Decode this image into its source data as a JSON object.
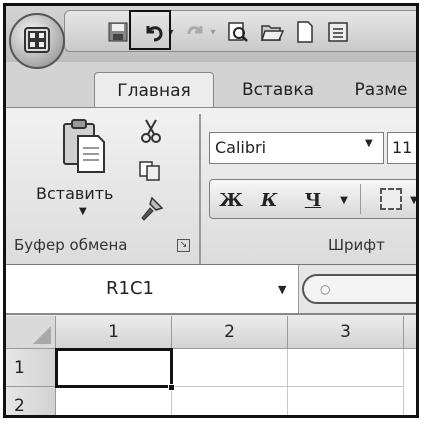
{
  "quick_access": {
    "office_button": "office-logo",
    "buttons": [
      "save-icon",
      "undo-icon",
      "undo-dropdown-icon",
      "redo-icon",
      "redo-dropdown-icon",
      "print-preview-icon",
      "open-icon",
      "new-icon",
      "customize-icon"
    ],
    "highlighted": "undo-button"
  },
  "tabs": [
    {
      "label": "Главная",
      "active": true
    },
    {
      "label": "Вставка",
      "active": false
    },
    {
      "label": "Разме",
      "active": false
    }
  ],
  "clipboard": {
    "paste_label": "Вставить",
    "group_label": "Буфер обмена",
    "icons": [
      "cut-icon",
      "copy-icon",
      "format-painter-icon"
    ]
  },
  "font": {
    "name": "Calibri",
    "size": "11",
    "bold_label": "Ж",
    "italic_label": "К",
    "underline_label": "Ч",
    "group_label": "Шрифт"
  },
  "formula_bar": {
    "name_box_value": "R1C1"
  },
  "grid": {
    "columns": [
      "1",
      "2",
      "3"
    ],
    "rows": [
      "1",
      "2"
    ],
    "active_cell": "R1C1"
  }
}
